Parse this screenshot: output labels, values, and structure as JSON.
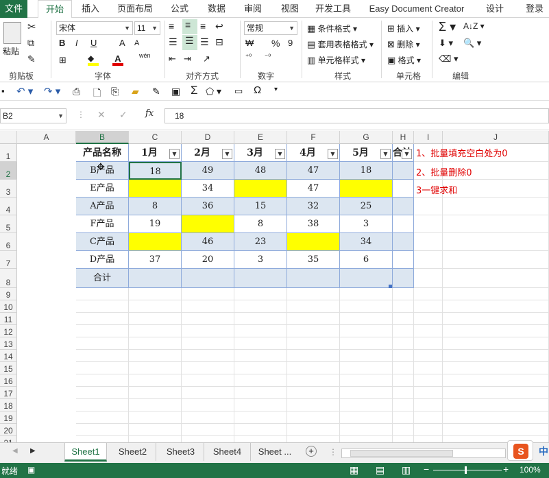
{
  "ribbon_tabs": [
    "文件",
    "开始",
    "插入",
    "页面布局",
    "公式",
    "数据",
    "审阅",
    "视图",
    "开发工具",
    "Easy Document Creator",
    "设计",
    "登录"
  ],
  "clipboard": {
    "paste": "粘贴",
    "label": "剪贴板"
  },
  "font": {
    "name": "宋体",
    "size": "11",
    "label": "字体",
    "bold": "B",
    "italic": "I",
    "underline": "U",
    "grow": "A",
    "shrink": "A",
    "phonetic": "wén"
  },
  "alignment": {
    "label": "对齐方式"
  },
  "number": {
    "format": "常规",
    "label": "数字",
    "percent": "%",
    "comma": "9"
  },
  "styles": {
    "conditional": "条件格式",
    "table": "套用表格格式",
    "cell": "单元格样式",
    "label": "样式"
  },
  "cells": {
    "insert": "插入",
    "delete": "删除",
    "format": "格式",
    "label": "单元格"
  },
  "editing": {
    "label": "编辑"
  },
  "formula_bar": {
    "name_box": "B2",
    "value": "18",
    "fx": "fx"
  },
  "columns": [
    "A",
    "B",
    "C",
    "D",
    "E",
    "F",
    "G",
    "H",
    "I",
    "J"
  ],
  "rows": [
    "1",
    "2",
    "3",
    "4",
    "5",
    "6",
    "7",
    "8",
    "9",
    "10",
    "11",
    "12",
    "13",
    "14",
    "15",
    "16",
    "17",
    "18",
    "19",
    "20",
    "21"
  ],
  "table": {
    "headers": [
      "产品名称",
      "1月",
      "2月",
      "3月",
      "4月",
      "5月",
      "合计"
    ],
    "data": [
      [
        "B产品",
        "18",
        "49",
        "48",
        "47",
        "18",
        ""
      ],
      [
        "E产品",
        "",
        "34",
        "",
        "47",
        "",
        ""
      ],
      [
        "A产品",
        "8",
        "36",
        "15",
        "32",
        "25",
        ""
      ],
      [
        "F产品",
        "19",
        "",
        "8",
        "38",
        "3",
        ""
      ],
      [
        "C产品",
        "",
        "46",
        "23",
        "",
        "34",
        ""
      ],
      [
        "D产品",
        "37",
        "20",
        "3",
        "35",
        "6",
        ""
      ]
    ],
    "total_label": "合计"
  },
  "notes": [
    "1、批量填充空白处为0",
    "2、批量删除0",
    "3一键求和"
  ],
  "sheets": [
    "Sheet1",
    "Sheet2",
    "Sheet3",
    "Sheet4",
    "Sheet ..."
  ],
  "status": {
    "ready": "就绪",
    "zoom": "100%"
  },
  "colors": {
    "accent": "#217346",
    "band": "#dce6f1",
    "highlight": "#ffff00",
    "note": "#e00000"
  }
}
